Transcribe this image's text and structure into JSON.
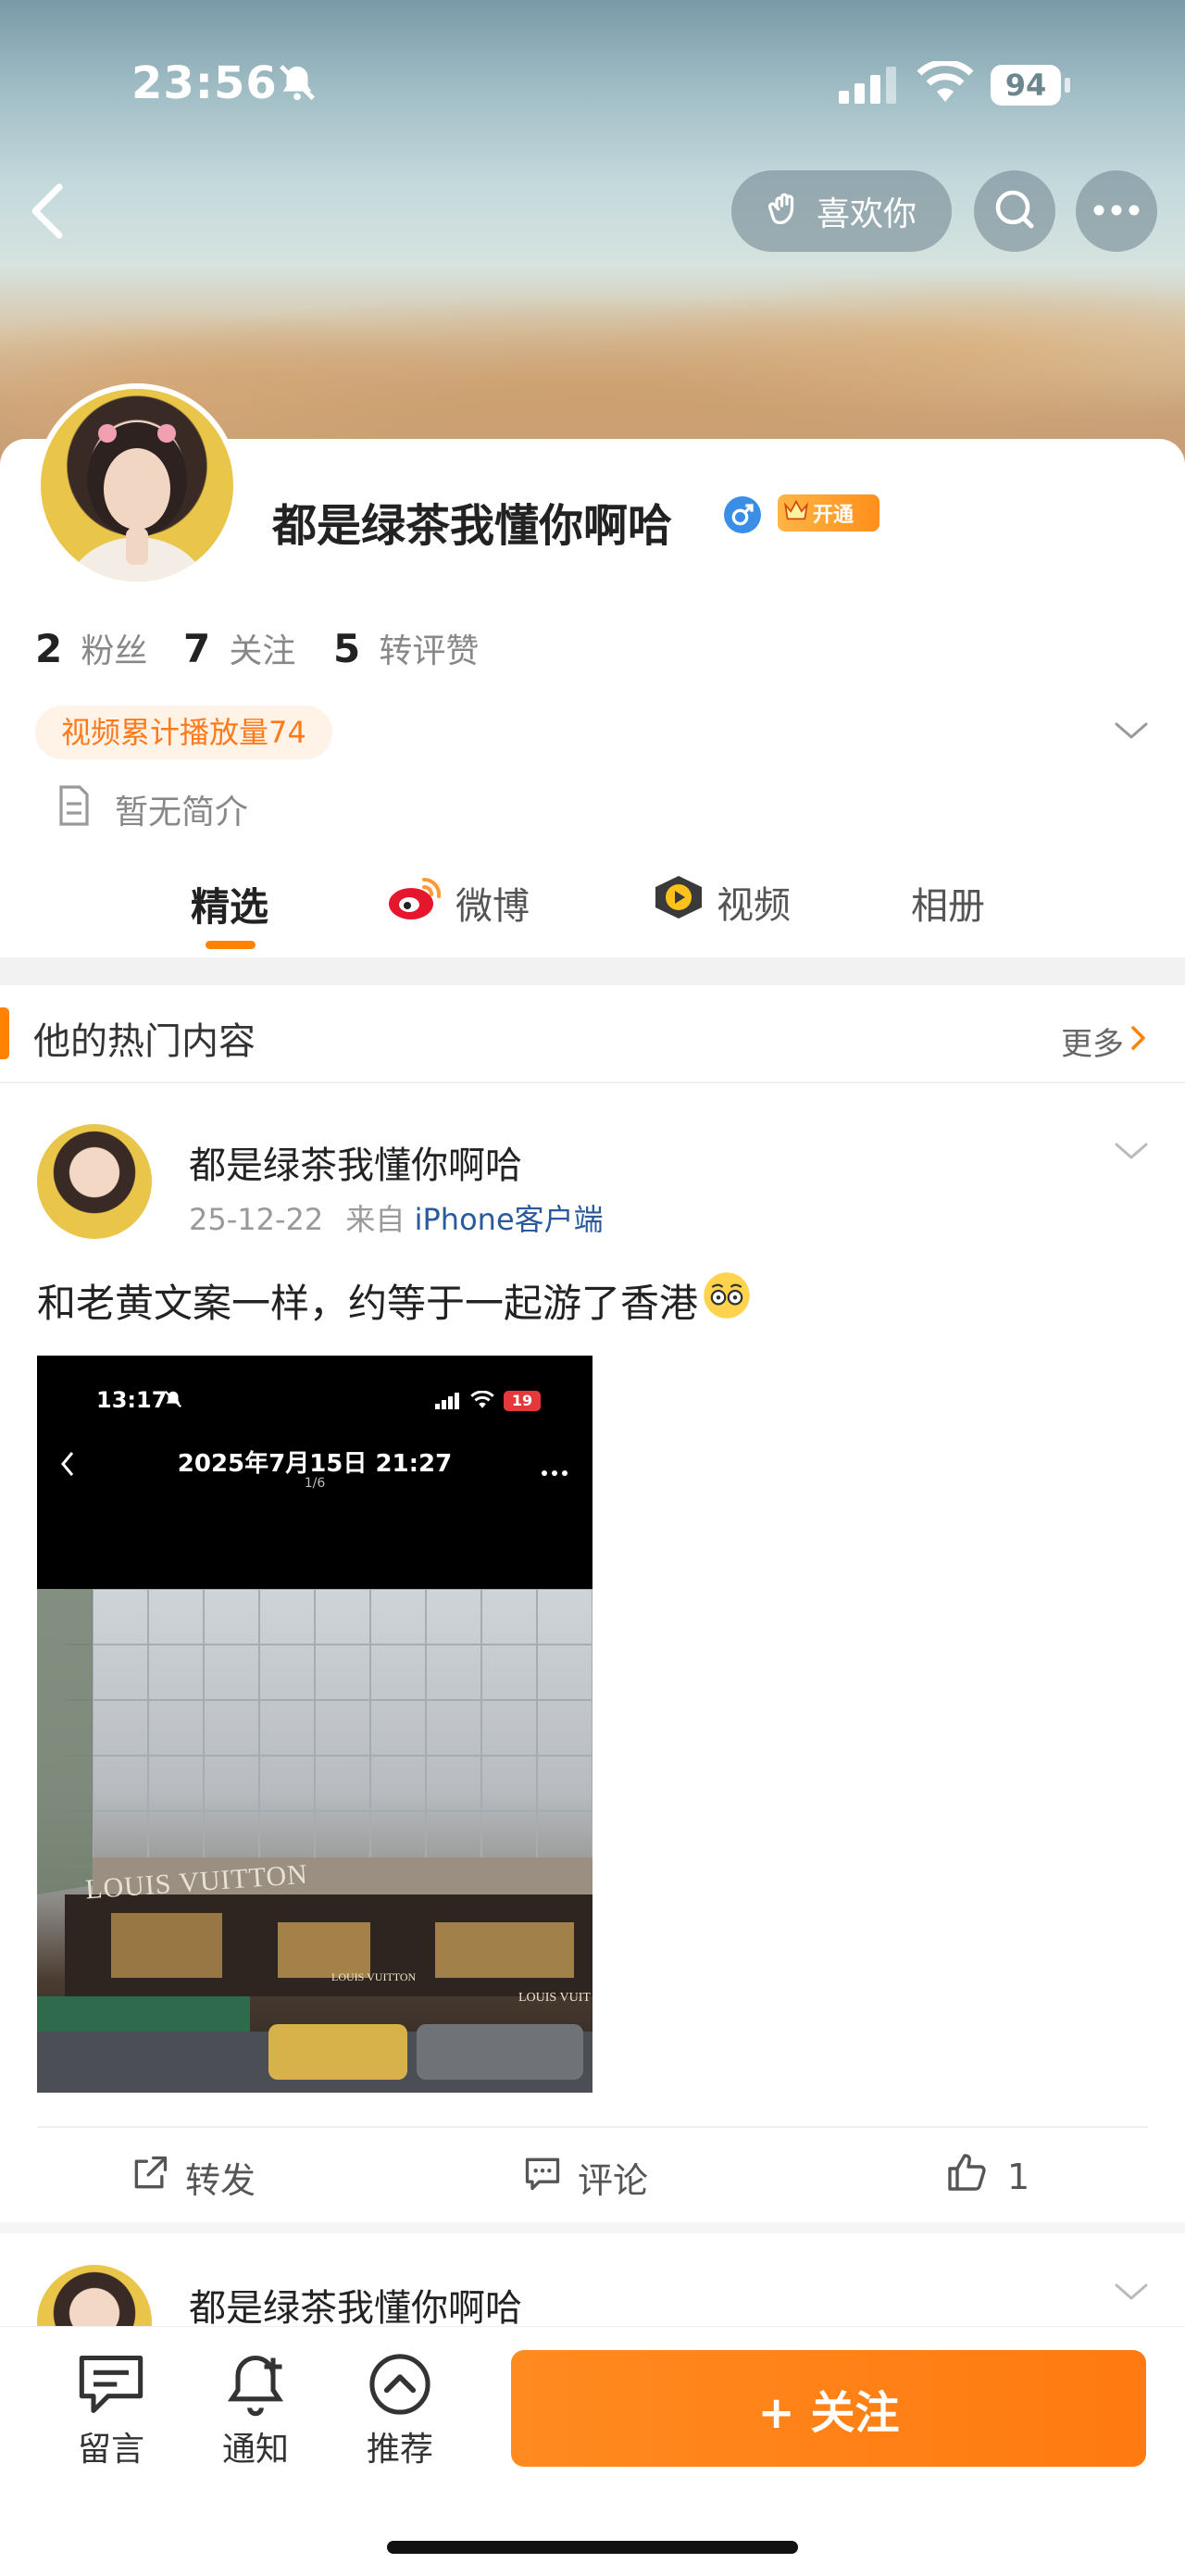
{
  "status_bar": {
    "time": "23:56",
    "battery": "94"
  },
  "header": {
    "like_you_label": "喜欢你"
  },
  "profile": {
    "name": "都是绿茶我懂你啊哈",
    "vip_badge": "开通",
    "stats": [
      {
        "value": "2",
        "label": "粉丝"
      },
      {
        "value": "7",
        "label": "关注"
      },
      {
        "value": "5",
        "label": "转评赞"
      }
    ],
    "video_views": "视频累计播放量74",
    "bio": "暂无简介"
  },
  "tabs": [
    {
      "label": "精选",
      "active": true
    },
    {
      "label": "微博",
      "active": false
    },
    {
      "label": "视频",
      "active": false
    },
    {
      "label": "相册",
      "active": false
    }
  ],
  "hot_section": {
    "title": "他的热门内容",
    "more_label": "更多"
  },
  "posts": [
    {
      "author": "都是绿茶我懂你啊哈",
      "date": "25-12-22",
      "source_prefix": "来自",
      "source": "iPhone客户端",
      "text": "和老黄文案一样，约等于一起游了香港",
      "image": {
        "time": "13:17",
        "battery": "19",
        "title": "2025年7月15日 21:27",
        "counter": "1/6",
        "signs": [
          "LOUIS VUITTON",
          "LOUIS VUITTON",
          "LOUIS VUIT"
        ]
      },
      "actions": {
        "repost": "转发",
        "comment": "评论",
        "like_count": "1"
      }
    },
    {
      "author": "都是绿茶我懂你啊哈"
    }
  ],
  "bottom_bar": {
    "items": [
      {
        "label": "留言",
        "icon": "message-icon"
      },
      {
        "label": "通知",
        "icon": "bell-add-icon"
      },
      {
        "label": "推荐",
        "icon": "chevron-up-circle-icon"
      }
    ],
    "follow_label": "+ 关注"
  },
  "colors": {
    "accent": "#ff8200",
    "link": "#2a5a9c",
    "vip": "#f0a020"
  }
}
